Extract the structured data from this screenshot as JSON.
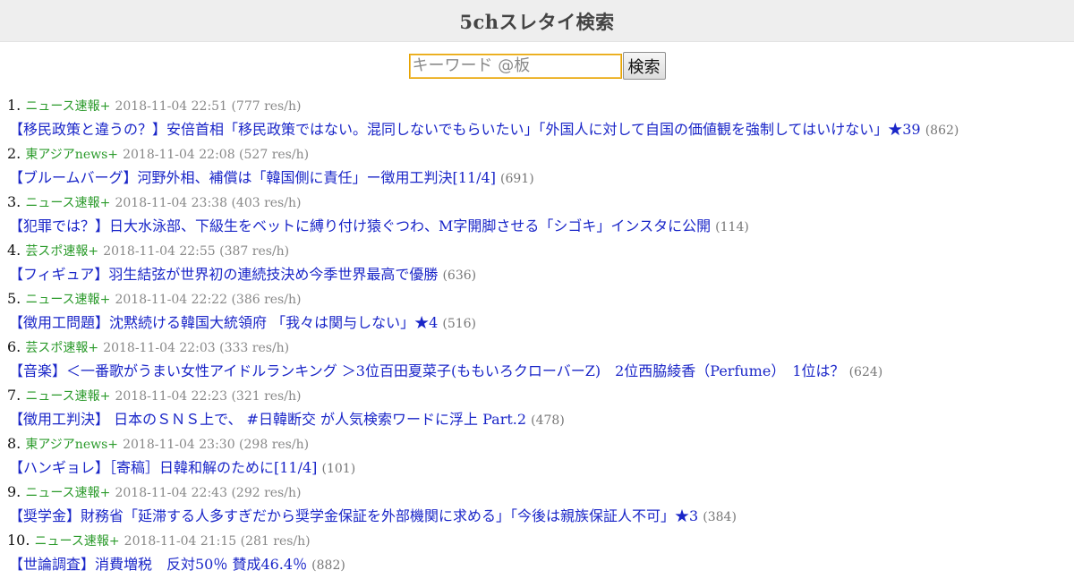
{
  "header": {
    "title": "5chスレタイ検索"
  },
  "search": {
    "placeholder": "キーワード @板",
    "value": "",
    "button_label": "検索"
  },
  "results": [
    {
      "num": "1.",
      "board": "ニュース速報+",
      "time": "2018-11-04 22:51 (777 res/h)",
      "title": "【移民政策と違うの？】安倍首相「移民政策ではない。混同しないでもらいたい」「外国人に対して自国の価値観を強制してはいけない」★39",
      "count": "(862)"
    },
    {
      "num": "2.",
      "board": "東アジアnews+",
      "time": "2018-11-04 22:08 (527 res/h)",
      "title": "【ブルームバーグ】河野外相、補償は「韓国側に責任」ー徴用工判決[11/4]",
      "count": "(691)"
    },
    {
      "num": "3.",
      "board": "ニュース速報+",
      "time": "2018-11-04 23:38 (403 res/h)",
      "title": "【犯罪では？】日大水泳部、下級生をベットに縛り付け猿ぐつわ、M字開脚させる「シゴキ」インスタに公開",
      "count": "(114)"
    },
    {
      "num": "4.",
      "board": "芸スポ速報+",
      "time": "2018-11-04 22:55 (387 res/h)",
      "title": "【フィギュア】羽生結弦が世界初の連続技決め今季世界最高で優勝",
      "count": "(636)"
    },
    {
      "num": "5.",
      "board": "ニュース速報+",
      "time": "2018-11-04 22:22 (386 res/h)",
      "title": "【徴用工問題】沈黙続ける韓国大統領府 「我々は関与しない」★4",
      "count": "(516)"
    },
    {
      "num": "6.",
      "board": "芸スポ速報+",
      "time": "2018-11-04 22:03 (333 res/h)",
      "title": "【音楽】＜一番歌がうまい女性アイドルランキング ＞3位百田夏菜子(ももいろクローバーZ)　2位西脇綾香（Perfume）　1位は？",
      "count": "(624)"
    },
    {
      "num": "7.",
      "board": "ニュース速報+",
      "time": "2018-11-04 22:23 (321 res/h)",
      "title": "【徴用工判決】 日本のＳＮＳ上で、 #日韓断交 が人気検索ワードに浮上 Part.2",
      "count": "(478)"
    },
    {
      "num": "8.",
      "board": "東アジアnews+",
      "time": "2018-11-04 23:30 (298 res/h)",
      "title": "【ハンギョレ】［寄稿］日韓和解のために[11/4]",
      "count": "(101)"
    },
    {
      "num": "9.",
      "board": "ニュース速報+",
      "time": "2018-11-04 22:43 (292 res/h)",
      "title": "【奨学金】財務省「延滞する人多すぎだから奨学金保証を外部機関に求める」「今後は親族保証人不可」★3",
      "count": "(384)"
    },
    {
      "num": "10.",
      "board": "ニュース速報+",
      "time": "2018-11-04 21:15 (281 res/h)",
      "title": "【世論調査】消費増税　反対50％ 賛成46.4％",
      "count": "(882)"
    }
  ]
}
